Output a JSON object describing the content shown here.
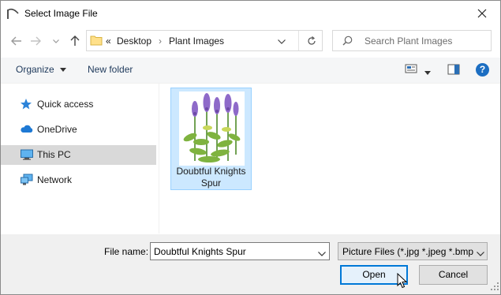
{
  "window": {
    "title": "Select Image File"
  },
  "address_bar": {
    "overflow": "«",
    "crumbs": [
      "Desktop",
      "Plant Images"
    ]
  },
  "search": {
    "placeholder": "Search Plant Images"
  },
  "toolbar": {
    "organize_label": "Organize",
    "new_folder_label": "New folder",
    "help_label": "?"
  },
  "sidebar": {
    "items": [
      {
        "label": "Quick access",
        "icon": "star-icon"
      },
      {
        "label": "OneDrive",
        "icon": "cloud-icon"
      },
      {
        "label": "This PC",
        "icon": "computer-icon",
        "selected": true
      },
      {
        "label": "Network",
        "icon": "network-icon"
      }
    ]
  },
  "files": [
    {
      "name": "Doubtful Knights Spur",
      "selected": true
    }
  ],
  "footer": {
    "file_name_label": "File name:",
    "file_name_value": "Doubtful Knights Spur",
    "file_type_value": "Picture Files (*.jpg *.jpeg *.bmp",
    "open_label": "Open",
    "cancel_label": "Cancel"
  },
  "colors": {
    "selection_bg": "#cce8ff",
    "selection_border": "#99d1ff",
    "accent": "#0078d7",
    "help": "#1c6ec2"
  }
}
